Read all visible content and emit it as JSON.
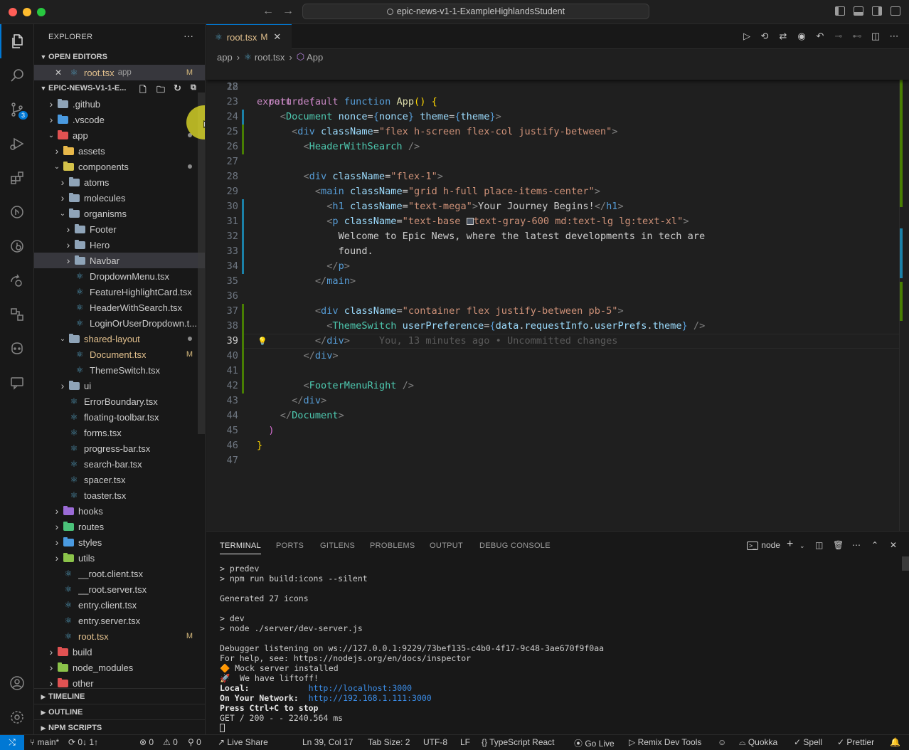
{
  "window": {
    "title": "epic-news-v1-1-ExampleHighlandsStudent",
    "nav_back": "←",
    "nav_forward": "→"
  },
  "activity_bar": {
    "items": [
      "explorer-icon",
      "search-icon",
      "source-control-icon",
      "run-debug-icon",
      "extensions-icon",
      "gitlens-icon",
      "timeline-icon",
      "live-share-icon",
      "remote-explorer-icon",
      "copilot-icon",
      "comments-icon"
    ],
    "scm_badge": "3",
    "bottom": [
      "account-icon",
      "settings-icon"
    ]
  },
  "sidebar": {
    "title": "EXPLORER",
    "more": "···",
    "open_editors": {
      "label": "OPEN EDITORS",
      "item": {
        "name": "root.tsx",
        "folder": "app",
        "status": "M"
      }
    },
    "project": {
      "label": "EPIC-NEWS-V1-1-E...",
      "tree": [
        {
          "name": ".github",
          "depth": 1,
          "kind": "folder",
          "expanded": false,
          "color": "#8fa4b8"
        },
        {
          "name": ".vscode",
          "depth": 1,
          "kind": "folder",
          "expanded": false,
          "color": "#4a9ae0"
        },
        {
          "name": "app",
          "depth": 1,
          "kind": "folder",
          "expanded": true,
          "color": "#e05252",
          "dot": true
        },
        {
          "name": "assets",
          "depth": 2,
          "kind": "folder",
          "expanded": false,
          "color": "#e8b84a"
        },
        {
          "name": "components",
          "depth": 2,
          "kind": "folder",
          "expanded": true,
          "color": "#d4c24a",
          "dot": true
        },
        {
          "name": "atoms",
          "depth": 3,
          "kind": "folder",
          "expanded": false,
          "color": "#8fa4b8"
        },
        {
          "name": "molecules",
          "depth": 3,
          "kind": "folder",
          "expanded": false,
          "color": "#8fa4b8"
        },
        {
          "name": "organisms",
          "depth": 3,
          "kind": "folder",
          "expanded": true,
          "color": "#8fa4b8"
        },
        {
          "name": "Footer",
          "depth": 4,
          "kind": "folder",
          "expanded": false,
          "color": "#8fa4b8"
        },
        {
          "name": "Hero",
          "depth": 4,
          "kind": "folder",
          "expanded": false,
          "color": "#8fa4b8"
        },
        {
          "name": "Navbar",
          "depth": 4,
          "kind": "folder",
          "expanded": false,
          "color": "#8fa4b8",
          "selected": true
        },
        {
          "name": "DropdownMenu.tsx",
          "depth": 4,
          "kind": "react"
        },
        {
          "name": "FeatureHighlightCard.tsx",
          "depth": 4,
          "kind": "react"
        },
        {
          "name": "HeaderWithSearch.tsx",
          "depth": 4,
          "kind": "react"
        },
        {
          "name": "LoginOrUserDropdown.t...",
          "depth": 4,
          "kind": "react"
        },
        {
          "name": "shared-layout",
          "depth": 3,
          "kind": "folder",
          "expanded": true,
          "color": "#8fa4b8",
          "dot": true,
          "modified": true
        },
        {
          "name": "Document.tsx",
          "depth": 4,
          "kind": "react",
          "status": "M"
        },
        {
          "name": "ThemeSwitch.tsx",
          "depth": 4,
          "kind": "react"
        },
        {
          "name": "ui",
          "depth": 3,
          "kind": "folder",
          "expanded": false,
          "color": "#8fa4b8"
        },
        {
          "name": "ErrorBoundary.tsx",
          "depth": 3,
          "kind": "react"
        },
        {
          "name": "floating-toolbar.tsx",
          "depth": 3,
          "kind": "react"
        },
        {
          "name": "forms.tsx",
          "depth": 3,
          "kind": "react"
        },
        {
          "name": "progress-bar.tsx",
          "depth": 3,
          "kind": "react"
        },
        {
          "name": "search-bar.tsx",
          "depth": 3,
          "kind": "react"
        },
        {
          "name": "spacer.tsx",
          "depth": 3,
          "kind": "react"
        },
        {
          "name": "toaster.tsx",
          "depth": 3,
          "kind": "react"
        },
        {
          "name": "hooks",
          "depth": 2,
          "kind": "folder",
          "expanded": false,
          "color": "#9b6bd6"
        },
        {
          "name": "routes",
          "depth": 2,
          "kind": "folder",
          "expanded": false,
          "color": "#4bc27a"
        },
        {
          "name": "styles",
          "depth": 2,
          "kind": "folder",
          "expanded": false,
          "color": "#4a9ae0"
        },
        {
          "name": "utils",
          "depth": 2,
          "kind": "folder",
          "expanded": false,
          "color": "#8bc34a"
        },
        {
          "name": "__root.client.tsx",
          "depth": 2,
          "kind": "react"
        },
        {
          "name": "__root.server.tsx",
          "depth": 2,
          "kind": "react"
        },
        {
          "name": "entry.client.tsx",
          "depth": 2,
          "kind": "react"
        },
        {
          "name": "entry.server.tsx",
          "depth": 2,
          "kind": "react"
        },
        {
          "name": "root.tsx",
          "depth": 2,
          "kind": "react",
          "status": "M"
        },
        {
          "name": "build",
          "depth": 1,
          "kind": "folder",
          "expanded": false,
          "color": "#e05252"
        },
        {
          "name": "node_modules",
          "depth": 1,
          "kind": "folder",
          "expanded": false,
          "color": "#8bc34a"
        },
        {
          "name": "other",
          "depth": 1,
          "kind": "folder",
          "expanded": false,
          "color": "#e05252"
        }
      ]
    },
    "bottom_sections": [
      "TIMELINE",
      "OUTLINE",
      "NPM SCRIPTS"
    ]
  },
  "editor": {
    "tab": {
      "name": "root.tsx",
      "status": "M",
      "close": "✕"
    },
    "breadcrumb": [
      "app",
      "root.tsx",
      "App"
    ],
    "sticky": {
      "num": "18",
      "html": "<span class='k'>export</span> <span class='k'>default</span> <span class='kb'>function</span> <span class='fn'>App</span><span class='br2'>()</span> <span class='br2'>{</span>"
    },
    "lines": [
      {
        "num": "22",
        "html": ""
      },
      {
        "num": "23",
        "html": "  <span class='k'>return</span> <span class='br'>(</span>"
      },
      {
        "num": "24",
        "html": "    <span class='pn'>&lt;</span><span class='tag'>Document</span> <span class='at'>nonce</span>=<span class='kb'>{</span><span class='at'>nonce</span><span class='kb'>}</span> <span class='at'>theme</span>=<span class='kb'>{</span><span class='at'>theme</span><span class='kb'>}</span><span class='pn'>&gt;</span>"
      },
      {
        "num": "25",
        "html": "      <span class='pn'>&lt;</span><span class='tg'>div</span> <span class='at'>className</span>=<span class='st'>\"flex h-screen flex-col justify-between\"</span><span class='pn'>&gt;</span>"
      },
      {
        "num": "26",
        "html": "        <span class='pn'>&lt;</span><span class='tag'>HeaderWithSearch</span> <span class='pn'>/&gt;</span>"
      },
      {
        "num": "27",
        "html": ""
      },
      {
        "num": "28",
        "html": "        <span class='pn'>&lt;</span><span class='tg'>div</span> <span class='at'>className</span>=<span class='st'>\"flex-1\"</span><span class='pn'>&gt;</span>"
      },
      {
        "num": "29",
        "html": "          <span class='pn'>&lt;</span><span class='tg'>main</span> <span class='at'>className</span>=<span class='st'>\"grid h-full place-items-center\"</span><span class='pn'>&gt;</span>"
      },
      {
        "num": "30",
        "html": "            <span class='pn'>&lt;</span><span class='tg'>h1</span> <span class='at'>className</span>=<span class='st'>\"text-mega\"</span><span class='pn'>&gt;</span>Your Journey Begins!<span class='pn'>&lt;/</span><span class='tg'>h1</span><span class='pn'>&gt;</span>"
      },
      {
        "num": "31",
        "html": "            <span class='pn'>&lt;</span><span class='tg'>p</span> <span class='at'>className</span>=<span class='st'>\"text-base </span><span style='display:inline-block;width:10px;height:10px;border:1px solid #ccc;background:#4b5563;vertical-align:-1px'></span><span class='st'>text-gray-600 md:text-lg lg:text-xl\"</span><span class='pn'>&gt;</span>"
      },
      {
        "num": "32",
        "html": "              Welcome to Epic News, where the latest developments in tech are"
      },
      {
        "num": "33",
        "html": "              found."
      },
      {
        "num": "34",
        "html": "            <span class='pn'>&lt;/</span><span class='tg'>p</span><span class='pn'>&gt;</span>"
      },
      {
        "num": "35",
        "html": "          <span class='pn'>&lt;/</span><span class='tg'>main</span><span class='pn'>&gt;</span>"
      },
      {
        "num": "36",
        "html": ""
      },
      {
        "num": "37",
        "html": "          <span class='pn'>&lt;</span><span class='tg'>div</span> <span class='at'>className</span>=<span class='st'>\"container flex justify-between pb-5\"</span><span class='pn'>&gt;</span>"
      },
      {
        "num": "38",
        "html": "            <span class='pn'>&lt;</span><span class='tag'>ThemeSwitch</span> <span class='at'>userPreference</span>=<span class='kb'>{</span><span class='at'>data</span>.<span class='at'>requestInfo</span>.<span class='at'>userPrefs</span>.<span class='at'>theme</span><span class='kb'>}</span> <span class='pn'>/&gt;</span>"
      },
      {
        "num": "39",
        "html": "          <span class='pn'>&lt;/</span><span class='tg'>div</span><span class='pn'>&gt;</span>     <span class='blame'>You, 13 minutes ago • Uncommitted changes</span>",
        "current": true
      },
      {
        "num": "40",
        "html": "        <span class='pn'>&lt;/</span><span class='tg'>div</span><span class='pn'>&gt;</span>"
      },
      {
        "num": "41",
        "html": ""
      },
      {
        "num": "42",
        "html": "        <span class='pn'>&lt;</span><span class='tag'>FooterMenuRight</span> <span class='pn'>/&gt;</span>"
      },
      {
        "num": "43",
        "html": "      <span class='pn'>&lt;/</span><span class='tg'>div</span><span class='pn'>&gt;</span>"
      },
      {
        "num": "44",
        "html": "    <span class='pn'>&lt;/</span><span class='tag'>Document</span><span class='pn'>&gt;</span>"
      },
      {
        "num": "45",
        "html": "  <span class='br'>)</span>"
      },
      {
        "num": "46",
        "html": "<span class='br2'>}</span>"
      },
      {
        "num": "47",
        "html": ""
      }
    ]
  },
  "panel": {
    "tabs": [
      "TERMINAL",
      "PORTS",
      "GITLENS",
      "PROBLEMS",
      "OUTPUT",
      "DEBUG CONSOLE"
    ],
    "active_tab": "TERMINAL",
    "terminal_name": "node",
    "terminal_lines": [
      {
        "text": "> predev"
      },
      {
        "text": "> npm run build:icons --silent"
      },
      {
        "text": ""
      },
      {
        "text": "Generated 27 icons"
      },
      {
        "text": ""
      },
      {
        "text": "> dev"
      },
      {
        "text": "> node ./server/dev-server.js"
      },
      {
        "text": ""
      },
      {
        "text": "Debugger listening on ws://127.0.0.1:9229/73bef135-c4b0-4f17-9c48-3ae670f9f0aa"
      },
      {
        "text": "For help, see: https://nodejs.org/en/docs/inspector"
      },
      {
        "text": "🔶 Mock server installed"
      },
      {
        "text": "🚀  We have liftoff!"
      },
      {
        "label": "Local:",
        "pad": "            ",
        "link": "http://localhost:3000"
      },
      {
        "label": "On Your Network:",
        "pad": "  ",
        "link": "http://192.168.1.111:3000"
      },
      {
        "label": "Press Ctrl+C to stop",
        "pad": "",
        "link": ""
      },
      {
        "text": "GET / 200 - - 2240.564 ms"
      }
    ]
  },
  "statusbar": {
    "remote": "⤭",
    "branch": "main*",
    "sync": "⟳ 0↓ 1↑",
    "errors": "⊗ 0",
    "warnings": "⚠ 0",
    "ports": "⚲ 0",
    "live_share": "Live Share",
    "position": "Ln 39, Col 17",
    "tab_size": "Tab Size: 2",
    "encoding": "UTF-8",
    "eol": "LF",
    "language": "TypeScript React",
    "go_live": "Go Live",
    "remix": "Remix Dev Tools",
    "quokka": "Quokka",
    "spell": "Spell",
    "prettier": "Prettier"
  }
}
